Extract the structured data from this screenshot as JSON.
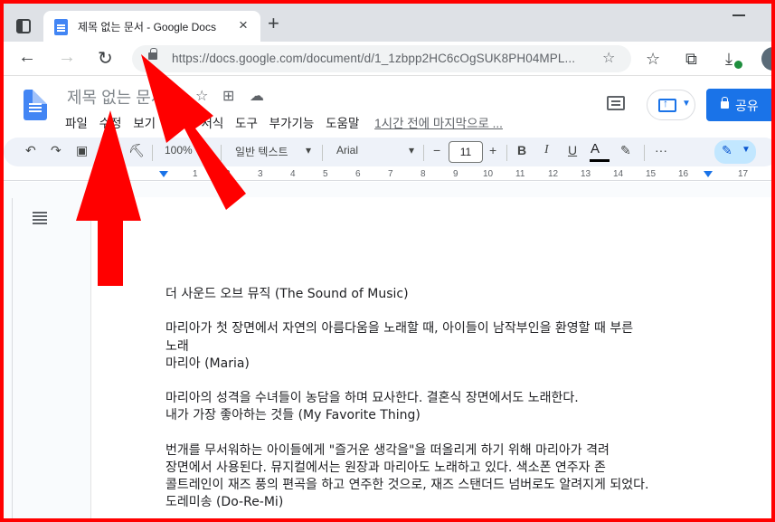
{
  "browser": {
    "tab_title": "제목 없는 문서 - Google Docs",
    "tab_close": "×",
    "new_tab": "+",
    "url": "https://docs.google.com/document/d/1_1zbpp2HC6cOgSUK8PH04MPL...",
    "icons": [
      "tab-actions-icon",
      "docs-favicon-icon",
      "back-arrow-icon",
      "forward-arrow-icon",
      "reload-icon",
      "lock-icon",
      "add-favorite-icon",
      "favorites-icon",
      "collections-icon",
      "downloads-icon",
      "profile-avatar-icon"
    ]
  },
  "docs_header": {
    "doc_title": "제목 없는 문서",
    "menu": [
      "파일",
      "수정",
      "보기",
      "삽입",
      "서식",
      "도구",
      "부가기능",
      "도움말"
    ],
    "last_edit": "1시간 전에 마지막으로 ...",
    "share_label": "공유"
  },
  "toolbar": {
    "zoom": "100%",
    "style": "일반 텍스트",
    "font": "Arial",
    "font_size": "11",
    "minus": "−",
    "plus": "+",
    "bold": "B",
    "italic": "I",
    "underline": "U",
    "text_color": "A",
    "more": "···"
  },
  "ruler": {
    "numbers": [
      "1",
      "2",
      "3",
      "4",
      "5",
      "6",
      "7",
      "8",
      "9",
      "10",
      "11",
      "12",
      "13",
      "14",
      "15",
      "16",
      "17"
    ]
  },
  "document": {
    "lines": [
      "더 사운드 오브 뮤직 (The Sound of Music)",
      "",
      "마리아가 첫 장면에서 자연의 아름다움을 노래할 때, 아이들이 남작부인을 환영할 때 부른",
      "노래",
      "마리아 (Maria)",
      "",
      "마리아의 성격을 수녀들이 농담을 하며 묘사한다. 결혼식 장면에서도 노래한다.",
      "내가 가장 좋아하는 것들 (My Favorite Thing)",
      "",
      "번개를 무서워하는 아이들에게 \"즐거운 생각을\"을 떠올리게 하기 위해 마리아가 격려",
      "장면에서 사용된다. 뮤지컬에서는 원장과 마리아도 노래하고 있다. 색소폰 연주자 존",
      "콜트레인이 재즈 풍의 편곡을 하고 연주한 것으로, 재즈 스탠더드 넘버로도 알려지게 되었다.",
      "도레미송 (Do-Re-Mi)"
    ]
  },
  "colors": {
    "frame_border": "#ff0000",
    "annotation_arrow": "#ff0000",
    "docs_blue": "#1a73e8",
    "toolbar_bg": "#eef2f9"
  }
}
